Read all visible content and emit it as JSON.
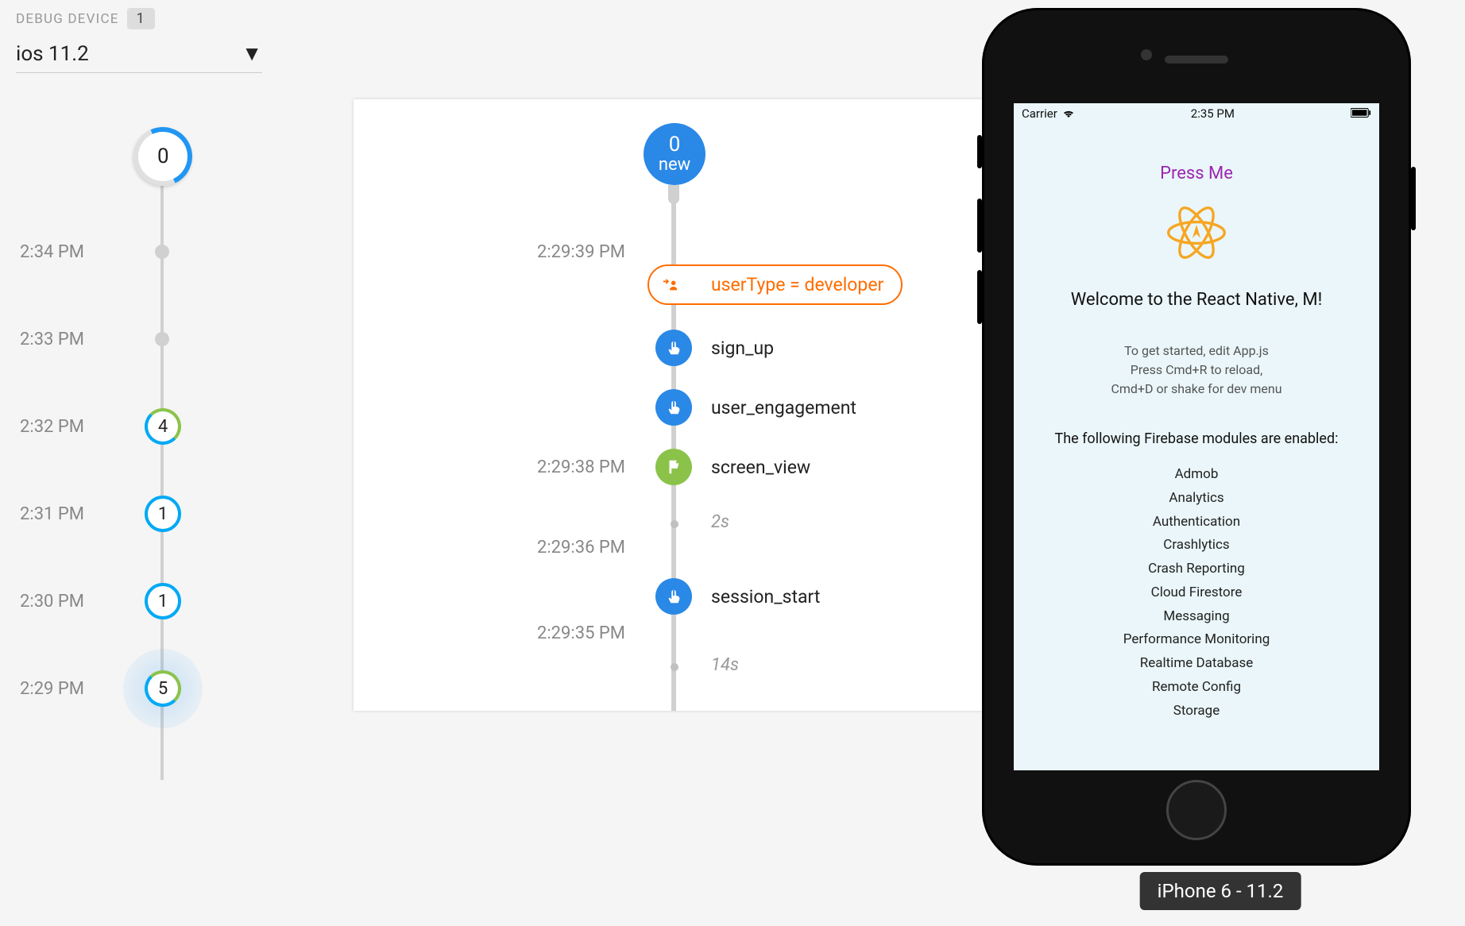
{
  "debug": {
    "title": "DEBUG DEVICE",
    "count": "1",
    "device": "ios 11.2"
  },
  "mini_timeline": {
    "current": "0",
    "rows": [
      {
        "time": "2:34 PM",
        "type": "dot"
      },
      {
        "time": "2:33 PM",
        "type": "dot"
      },
      {
        "time": "2:32 PM",
        "type": "mix",
        "label": "4"
      },
      {
        "time": "2:31 PM",
        "type": "cyan",
        "label": "1"
      },
      {
        "time": "2:30 PM",
        "type": "cyan",
        "label": "1"
      },
      {
        "time": "2:29 PM",
        "type": "mix",
        "label": "5",
        "halo": true
      }
    ]
  },
  "detail": {
    "new_count": "0",
    "new_label": "new",
    "user_property": "userType = developer",
    "ts1": "2:29:39 PM",
    "ts2": "2:29:38 PM",
    "ts3": "2:29:36 PM",
    "ts4": "2:29:35 PM",
    "events": {
      "sign_up": "sign_up",
      "user_engagement": "user_engagement",
      "screen_view": "screen_view",
      "session_start": "session_start"
    },
    "gap1": "2s",
    "gap2": "14s"
  },
  "phone": {
    "carrier": "Carrier",
    "time": "2:35 PM",
    "press_me": "Press Me",
    "welcome": "Welcome to the React Native, M!",
    "hint1": "To get started, edit App.js",
    "hint2": "Press Cmd+R to reload,",
    "hint3": "Cmd+D or shake for dev menu",
    "modules_title": "The following Firebase modules are enabled:",
    "modules": [
      "Admob",
      "Analytics",
      "Authentication",
      "Crashlytics",
      "Crash Reporting",
      "Cloud Firestore",
      "Messaging",
      "Performance Monitoring",
      "Realtime Database",
      "Remote Config",
      "Storage"
    ],
    "sim_label": "iPhone 6 - 11.2"
  }
}
